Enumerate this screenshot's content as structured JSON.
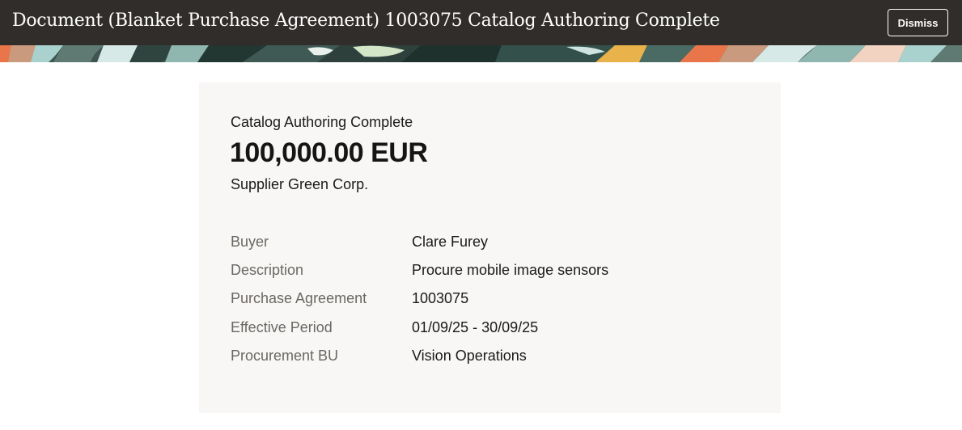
{
  "header": {
    "title": "Document (Blanket Purchase Agreement) 1003075 Catalog Authoring Complete",
    "dismiss_label": "Dismiss"
  },
  "card": {
    "status": "Catalog Authoring Complete",
    "amount": "100,000.00 EUR",
    "supplier": "Supplier Green Corp.",
    "details": [
      {
        "label": "Buyer",
        "value": "Clare Furey"
      },
      {
        "label": "Description",
        "value": "Procure mobile image sensors"
      },
      {
        "label": "Purchase Agreement",
        "value": "1003075"
      },
      {
        "label": "Effective Period",
        "value": "01/09/25 - 30/09/25"
      },
      {
        "label": "Procurement BU",
        "value": "Vision Operations"
      }
    ]
  },
  "colors": {
    "header_bg": "#312d2a",
    "card_bg": "#f8f7f5",
    "label_text": "#6b6864",
    "value_text": "#1c1a18"
  }
}
